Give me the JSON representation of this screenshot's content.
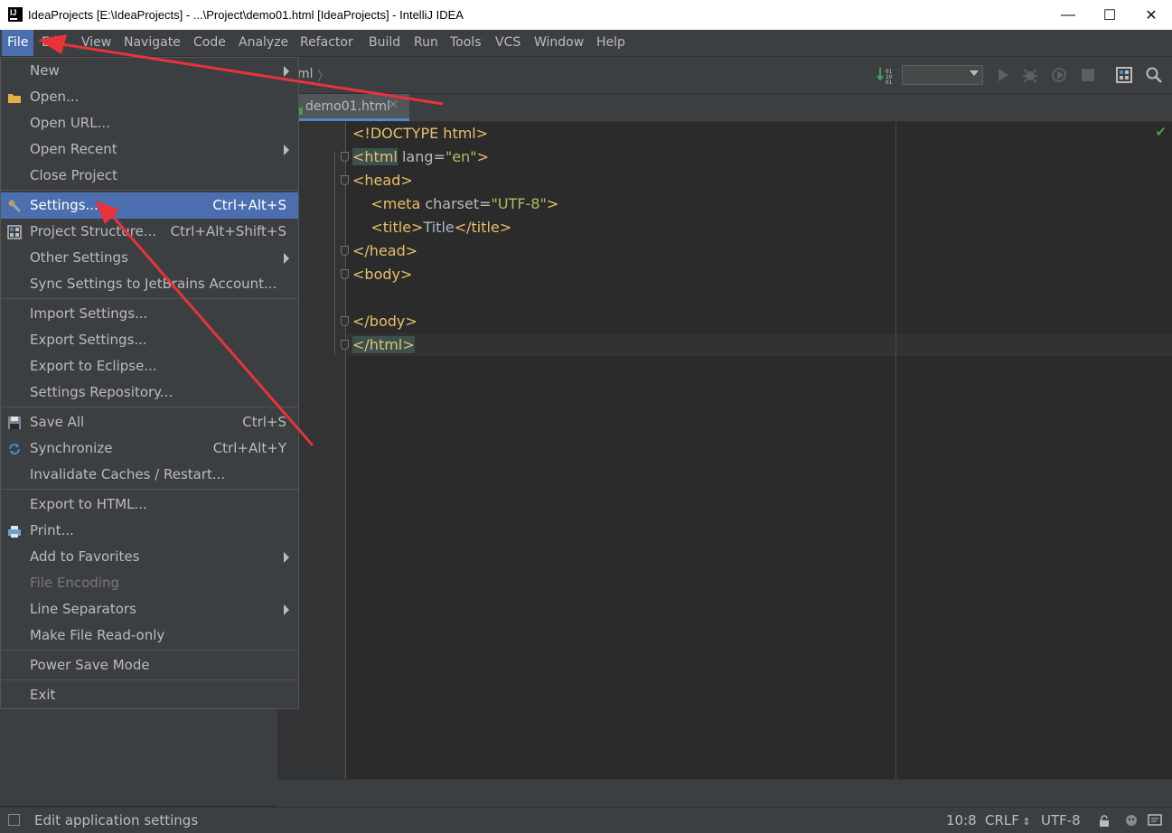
{
  "window": {
    "title": "IdeaProjects [E:\\IdeaProjects] - ...\\Project\\demo01.html [IdeaProjects] - IntelliJ IDEA",
    "minimize": "—",
    "maximize": "☐",
    "close": "✕"
  },
  "menubar": [
    "File",
    "Edit",
    "View",
    "Navigate",
    "Code",
    "Analyze",
    "Refactor",
    "Build",
    "Run",
    "Tools",
    "VCS",
    "Window",
    "Help"
  ],
  "breadcrumb": "ml",
  "editor_tab": "demo01.html",
  "code_lines": [
    {
      "segments": [
        {
          "t": "<!DOCTYPE ",
          "c": "tag"
        },
        {
          "t": "html",
          "c": "tag"
        },
        {
          "t": ">",
          "c": "tag"
        }
      ]
    },
    {
      "segments": [
        {
          "t": "<html",
          "c": "tag",
          "hl": true
        },
        {
          "t": " lang=",
          "c": "attr"
        },
        {
          "t": "\"en\"",
          "c": "val"
        },
        {
          "t": ">",
          "c": "tag"
        }
      ]
    },
    {
      "segments": [
        {
          "t": "<head>",
          "c": "tag"
        }
      ]
    },
    {
      "segments": [
        {
          "t": "    <meta ",
          "c": "tag"
        },
        {
          "t": "charset=",
          "c": "attr"
        },
        {
          "t": "\"UTF-8\"",
          "c": "val"
        },
        {
          "t": ">",
          "c": "tag"
        }
      ]
    },
    {
      "segments": [
        {
          "t": "    <title>",
          "c": "tag"
        },
        {
          "t": "Title",
          "c": "txt"
        },
        {
          "t": "</title>",
          "c": "tag"
        }
      ]
    },
    {
      "segments": [
        {
          "t": "</head>",
          "c": "tag"
        }
      ]
    },
    {
      "segments": [
        {
          "t": "<body>",
          "c": "tag"
        }
      ]
    },
    {
      "segments": [
        {
          "t": "",
          "c": "txt"
        }
      ]
    },
    {
      "segments": [
        {
          "t": "</body>",
          "c": "tag"
        }
      ]
    },
    {
      "segments": [
        {
          "t": "</html>",
          "c": "tag",
          "hl": true
        }
      ]
    }
  ],
  "file_menu": {
    "groups": [
      [
        {
          "label": "New",
          "shortcut": "",
          "submenu": true,
          "icon": ""
        },
        {
          "label": "Open...",
          "shortcut": "",
          "submenu": false,
          "icon": "folder-icon"
        },
        {
          "label": "Open URL...",
          "shortcut": "",
          "submenu": false,
          "icon": ""
        },
        {
          "label": "Open Recent",
          "shortcut": "",
          "submenu": true,
          "icon": ""
        },
        {
          "label": "Close Project",
          "shortcut": "",
          "submenu": false,
          "icon": ""
        }
      ],
      [
        {
          "label": "Settings...",
          "shortcut": "Ctrl+Alt+S",
          "submenu": false,
          "icon": "wrench-icon",
          "selected": true
        },
        {
          "label": "Project Structure...",
          "shortcut": "Ctrl+Alt+Shift+S",
          "submenu": false,
          "icon": "project-structure-icon"
        },
        {
          "label": "Other Settings",
          "shortcut": "",
          "submenu": true,
          "icon": ""
        },
        {
          "label": "Sync Settings to JetBrains Account...",
          "shortcut": "",
          "submenu": false,
          "icon": ""
        }
      ],
      [
        {
          "label": "Import Settings...",
          "shortcut": "",
          "submenu": false,
          "icon": ""
        },
        {
          "label": "Export Settings...",
          "shortcut": "",
          "submenu": false,
          "icon": ""
        },
        {
          "label": "Export to Eclipse...",
          "shortcut": "",
          "submenu": false,
          "icon": ""
        },
        {
          "label": "Settings Repository...",
          "shortcut": "",
          "submenu": false,
          "icon": ""
        }
      ],
      [
        {
          "label": "Save All",
          "shortcut": "Ctrl+S",
          "submenu": false,
          "icon": "save-icon"
        },
        {
          "label": "Synchronize",
          "shortcut": "Ctrl+Alt+Y",
          "submenu": false,
          "icon": "sync-icon"
        },
        {
          "label": "Invalidate Caches / Restart...",
          "shortcut": "",
          "submenu": false,
          "icon": ""
        }
      ],
      [
        {
          "label": "Export to HTML...",
          "shortcut": "",
          "submenu": false,
          "icon": ""
        },
        {
          "label": "Print...",
          "shortcut": "",
          "submenu": false,
          "icon": "print-icon"
        },
        {
          "label": "Add to Favorites",
          "shortcut": "",
          "submenu": true,
          "icon": ""
        },
        {
          "label": "File Encoding",
          "shortcut": "",
          "submenu": false,
          "icon": "",
          "disabled": true
        },
        {
          "label": "Line Separators",
          "shortcut": "",
          "submenu": true,
          "icon": ""
        },
        {
          "label": "Make File Read-only",
          "shortcut": "",
          "submenu": false,
          "icon": ""
        }
      ],
      [
        {
          "label": "Power Save Mode",
          "shortcut": "",
          "submenu": false,
          "icon": ""
        }
      ],
      [
        {
          "label": "Exit",
          "shortcut": "",
          "submenu": false,
          "icon": ""
        }
      ]
    ]
  },
  "statusbar": {
    "message": "Edit application settings",
    "position": "10:8",
    "line_separator": "CRLF",
    "encoding": "UTF-8"
  },
  "colors": {
    "accent": "#4b6eaf",
    "annotation_arrow": "#e8333a",
    "tag": "#e8bf6a",
    "string": "#a5c25c"
  }
}
